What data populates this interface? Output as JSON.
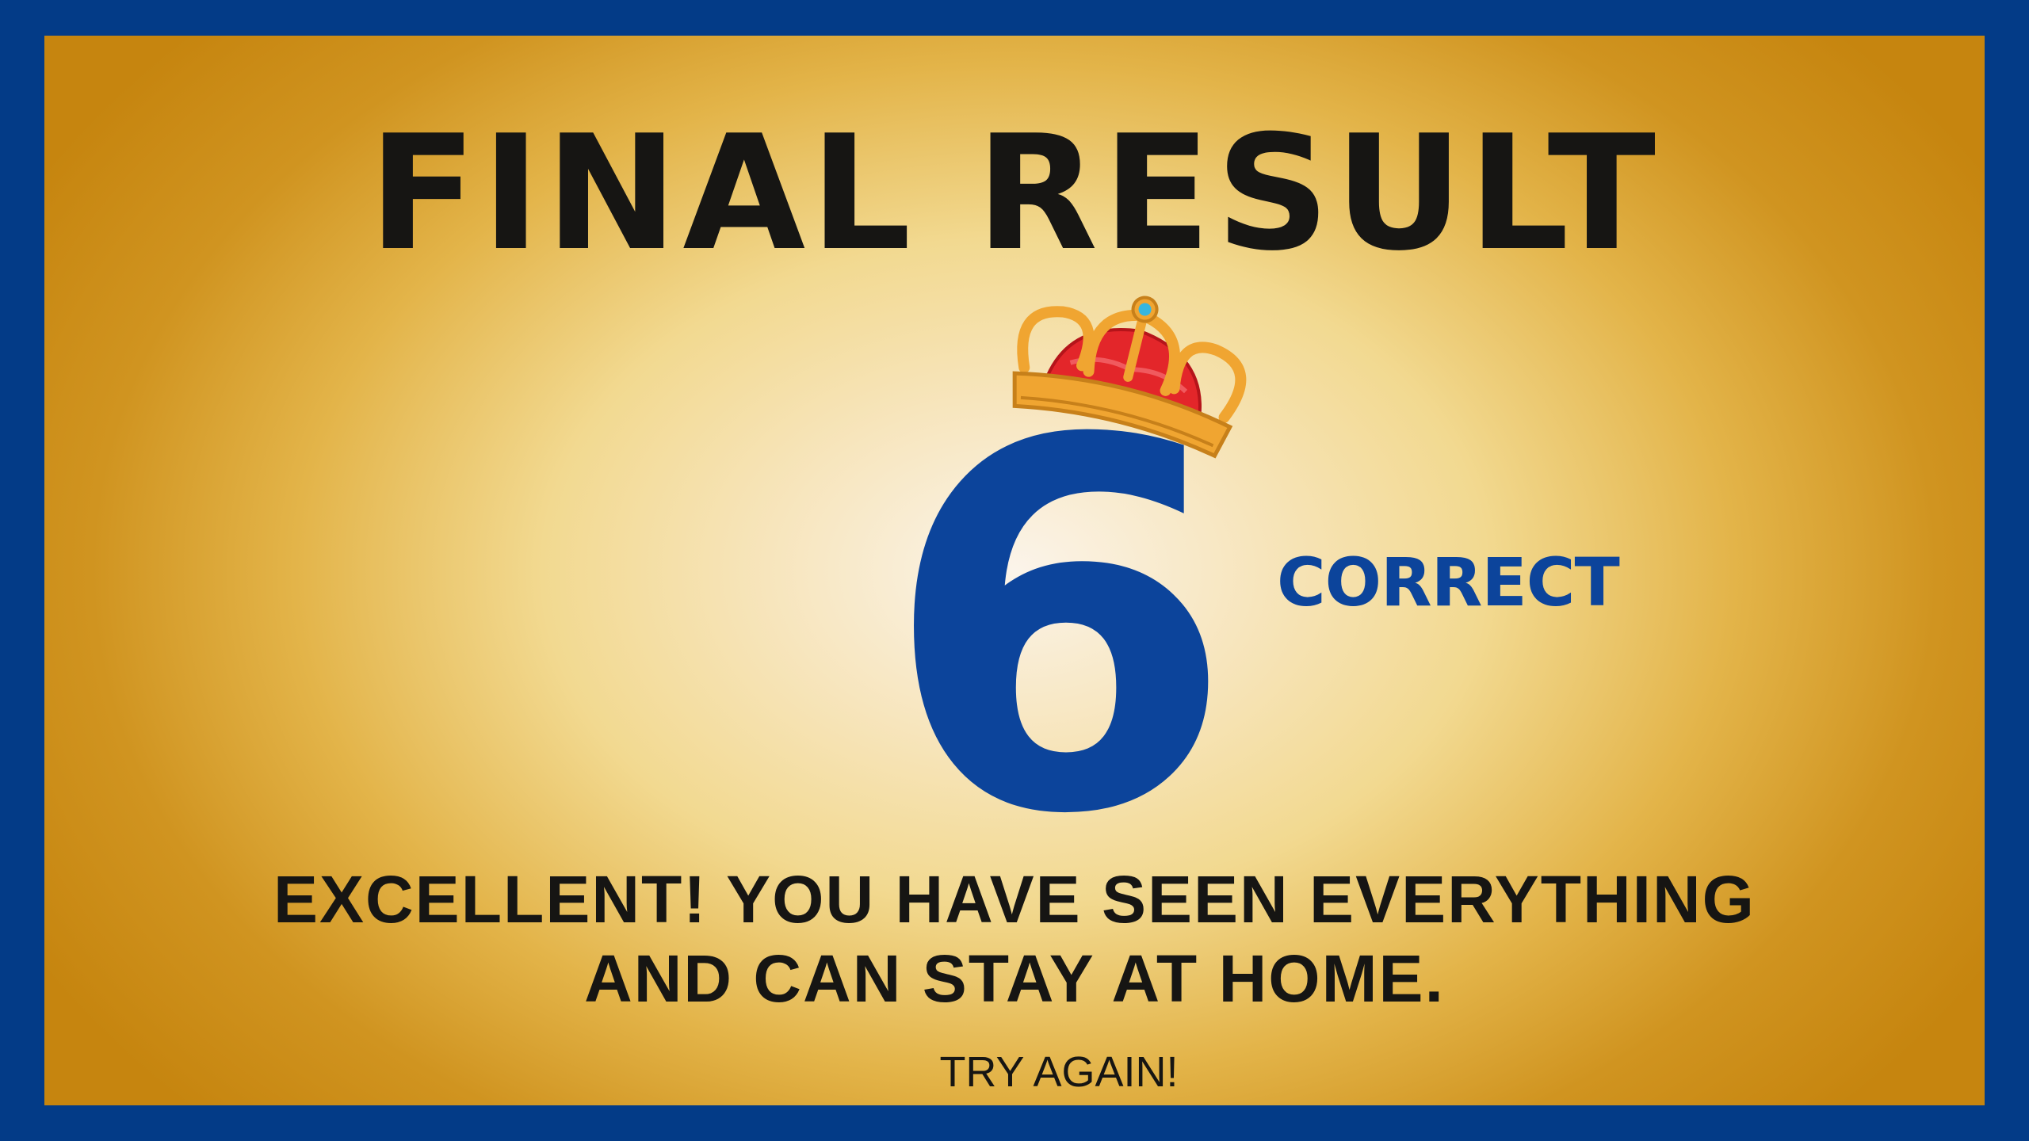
{
  "screen": {
    "title": "FINAL RESULT",
    "score": "6",
    "score_unit": "CORRECT",
    "message_line1": "EXCELLENT! YOU HAVE SEEN EVERYTHING",
    "message_line2": "AND CAN STAY AT HOME.",
    "try_again_label": "TRY AGAIN!"
  },
  "colors": {
    "frame": "#033b87",
    "score": "#0c449b",
    "text": "#161513",
    "panel_center": "#fbf4ea",
    "panel_edge": "#c6850f",
    "crown_gold": "#f0a531",
    "crown_red": "#e3262a",
    "crown_jewel": "#36b6e0"
  },
  "icons": {
    "crown": "crown-icon"
  }
}
